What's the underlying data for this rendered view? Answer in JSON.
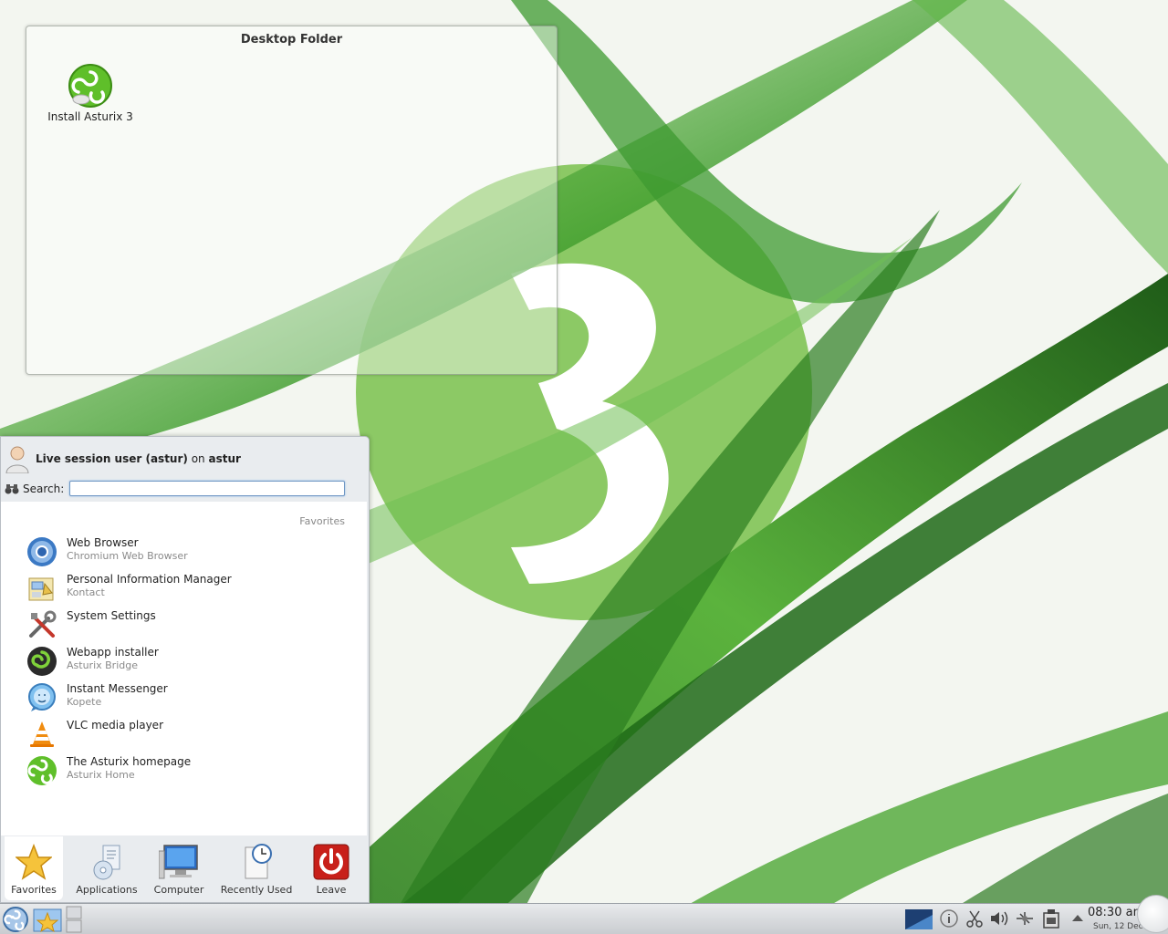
{
  "desktop_folder": {
    "title": "Desktop Folder",
    "icons": [
      {
        "label": "Install Asturix 3",
        "icon": "asturix-install-icon"
      }
    ]
  },
  "kickoff": {
    "user_name": "Live session user (astur)",
    "user_on": "on",
    "host": "astur",
    "search_label": "Search:",
    "search_value": "",
    "section_header": "Favorites",
    "favorites": [
      {
        "title": "Web Browser",
        "subtitle": "Chromium Web Browser",
        "icon": "chromium-icon"
      },
      {
        "title": "Personal Information Manager",
        "subtitle": "Kontact",
        "icon": "kontact-icon"
      },
      {
        "title": "System Settings",
        "subtitle": "",
        "icon": "system-settings-icon"
      },
      {
        "title": "Webapp installer",
        "subtitle": "Asturix Bridge",
        "icon": "asturix-bridge-icon"
      },
      {
        "title": "Instant Messenger",
        "subtitle": "Kopete",
        "icon": "kopete-icon"
      },
      {
        "title": "VLC media player",
        "subtitle": "",
        "icon": "vlc-icon"
      },
      {
        "title": "The Asturix homepage",
        "subtitle": "Asturix Home",
        "icon": "asturix-home-icon"
      }
    ],
    "tabs": [
      {
        "label": "Favorites",
        "icon": "star-icon",
        "active": true
      },
      {
        "label": "Applications",
        "icon": "applications-icon"
      },
      {
        "label": "Computer",
        "icon": "computer-icon"
      },
      {
        "label": "Recently Used",
        "icon": "recently-used-icon"
      },
      {
        "label": "Leave",
        "icon": "power-icon"
      }
    ]
  },
  "panel": {
    "clock_time": "08:30 am",
    "clock_date": "Sun, 12 Dec",
    "tray_icons": [
      "display-icon",
      "info-icon",
      "klipper-scissors-icon",
      "volume-icon",
      "network-icon",
      "device-notifier-icon",
      "expand-arrow-icon"
    ]
  },
  "colors": {
    "wallpaper_green": "#3f9a2f",
    "logo_green": "#8cc965",
    "kickoff_bg": "#e9ecef"
  }
}
